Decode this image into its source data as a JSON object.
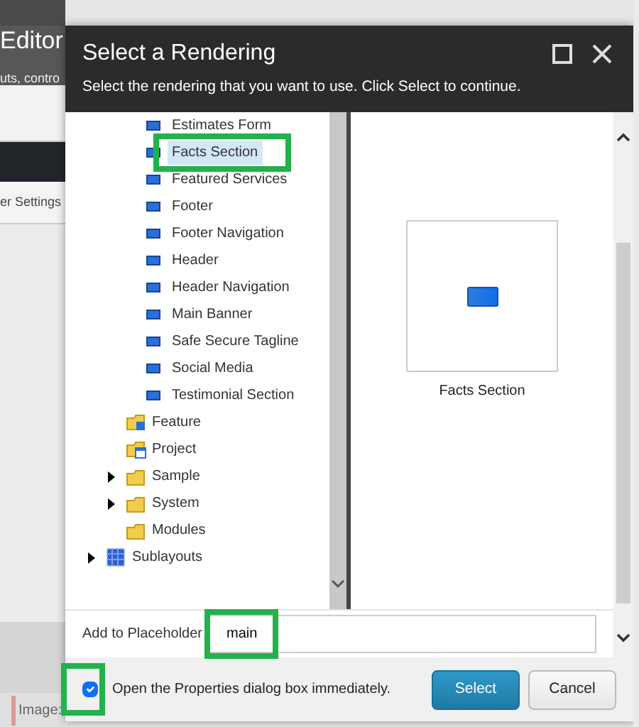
{
  "background": {
    "title": "Editor",
    "subtitle": "uts, contro",
    "tab": "er Settings",
    "field_label": "Image:"
  },
  "dialog": {
    "title": "Select a Rendering",
    "subtitle": "Select the rendering that you want to use. Click Select to continue.",
    "tree": [
      {
        "children": [
          {
            "children": [
              {
                "label": "Estimates Form",
                "kind": "rendering",
                "selected": false,
                "highlighted": false,
                "collapsed": false
              },
              {
                "label": "Facts Section",
                "kind": "rendering",
                "selected": true,
                "highlighted": true,
                "collapsed": false
              },
              {
                "label": "Featured Services",
                "kind": "rendering",
                "selected": false,
                "highlighted": false,
                "collapsed": false
              },
              {
                "label": "Footer",
                "kind": "rendering",
                "selected": false,
                "highlighted": false,
                "collapsed": false
              },
              {
                "label": "Footer Navigation",
                "kind": "rendering",
                "selected": false,
                "highlighted": false,
                "collapsed": false
              },
              {
                "label": "Header",
                "kind": "rendering",
                "selected": false,
                "highlighted": false,
                "collapsed": false
              },
              {
                "label": "Header Navigation",
                "kind": "rendering",
                "selected": false,
                "highlighted": false,
                "collapsed": false
              },
              {
                "label": "Main Banner",
                "kind": "rendering",
                "selected": false,
                "highlighted": false,
                "collapsed": false
              },
              {
                "label": "Safe Secure Tagline",
                "kind": "rendering",
                "selected": false,
                "highlighted": false,
                "collapsed": false
              },
              {
                "label": "Social Media",
                "kind": "rendering",
                "selected": false,
                "highlighted": false,
                "collapsed": false
              },
              {
                "label": "Testimonial Section",
                "kind": "rendering",
                "selected": false,
                "highlighted": false,
                "collapsed": false
              }
            ]
          },
          {
            "label": "Feature",
            "kind": "feature",
            "selected": false,
            "highlighted": false,
            "collapsed": false
          },
          {
            "label": "Project",
            "kind": "project",
            "selected": false,
            "highlighted": false,
            "collapsed": false
          },
          {
            "label": "Sample",
            "kind": "folder",
            "selected": false,
            "highlighted": false,
            "collapsed": true
          },
          {
            "label": "System",
            "kind": "folder",
            "selected": false,
            "highlighted": false,
            "collapsed": true
          },
          {
            "label": "Modules",
            "kind": "folder",
            "selected": false,
            "highlighted": false,
            "collapsed": false
          }
        ]
      },
      {
        "label": "Sublayouts",
        "kind": "sublayout",
        "selected": false,
        "highlighted": false,
        "collapsed": true
      }
    ],
    "preview": {
      "label": "Facts Section"
    },
    "placeholder_field": {
      "label": "Add to Placeholder",
      "value": "main",
      "highlighted": true
    },
    "open_properties": {
      "label": "Open the Properties dialog box immediately.",
      "checked": true,
      "highlighted": true
    },
    "buttons": [
      {
        "label": "Select",
        "kind": "primary"
      },
      {
        "label": "Cancel",
        "kind": "secondary"
      }
    ]
  }
}
